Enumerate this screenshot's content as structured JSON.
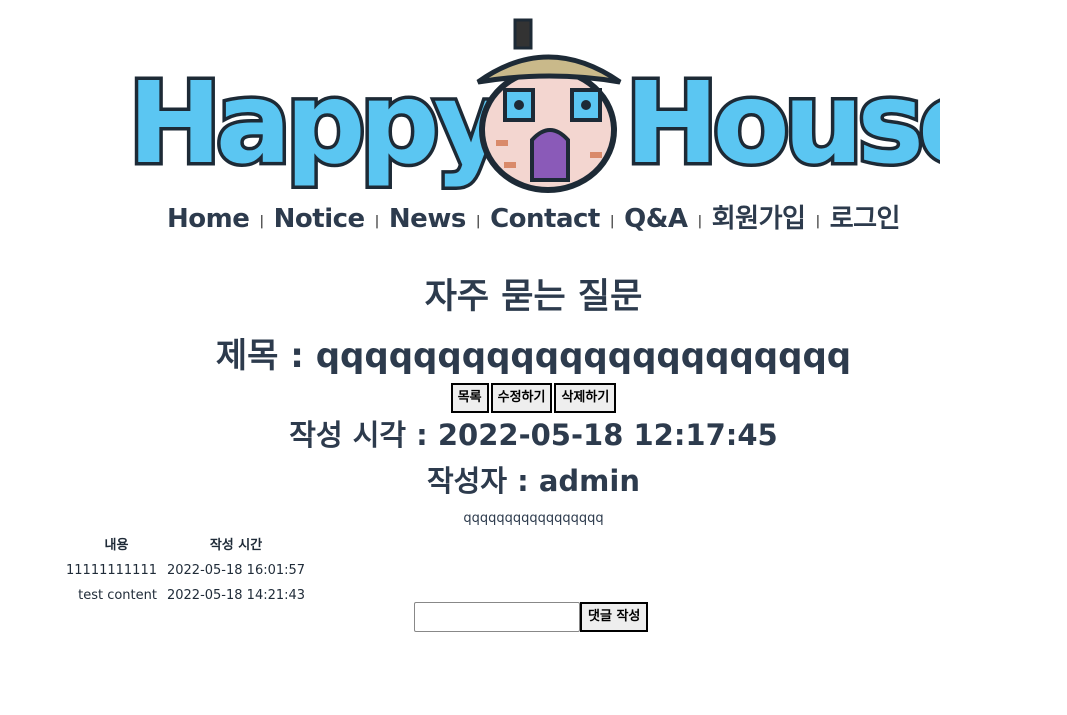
{
  "logo": {
    "text_left": "Happy",
    "text_right": "House",
    "alt": "HappyHouse"
  },
  "nav": {
    "items": [
      "Home",
      "Notice",
      "News",
      "Contact",
      "Q&A",
      "회원가입",
      "로그인"
    ],
    "separator": "|"
  },
  "page": {
    "title": "자주 묻는 질문"
  },
  "post": {
    "title_label": "제목 : ",
    "title_value": "qqqqqqqqqqqqqqqqqqqqqq",
    "buttons": {
      "list": "목록",
      "edit": "수정하기",
      "delete": "삭제하기"
    },
    "created_label": "작성 시각 : ",
    "created_value": "2022-05-18 12:17:45",
    "author_label": "작성자 : ",
    "author_value": "admin",
    "content": "qqqqqqqqqqqqqqqqq"
  },
  "comments": {
    "headers": [
      "내용",
      "작성 시간"
    ],
    "rows": [
      [
        "11111111111",
        "2022-05-18 16:01:57"
      ],
      [
        "test content",
        "2022-05-18 14:21:43"
      ]
    ]
  },
  "comment_form": {
    "input_value": "",
    "submit_label": "댓글 작성"
  },
  "colors": {
    "logo_blue": "#5bc6f2",
    "logo_outline": "#1d2a36",
    "text": "#2d3b4d"
  }
}
